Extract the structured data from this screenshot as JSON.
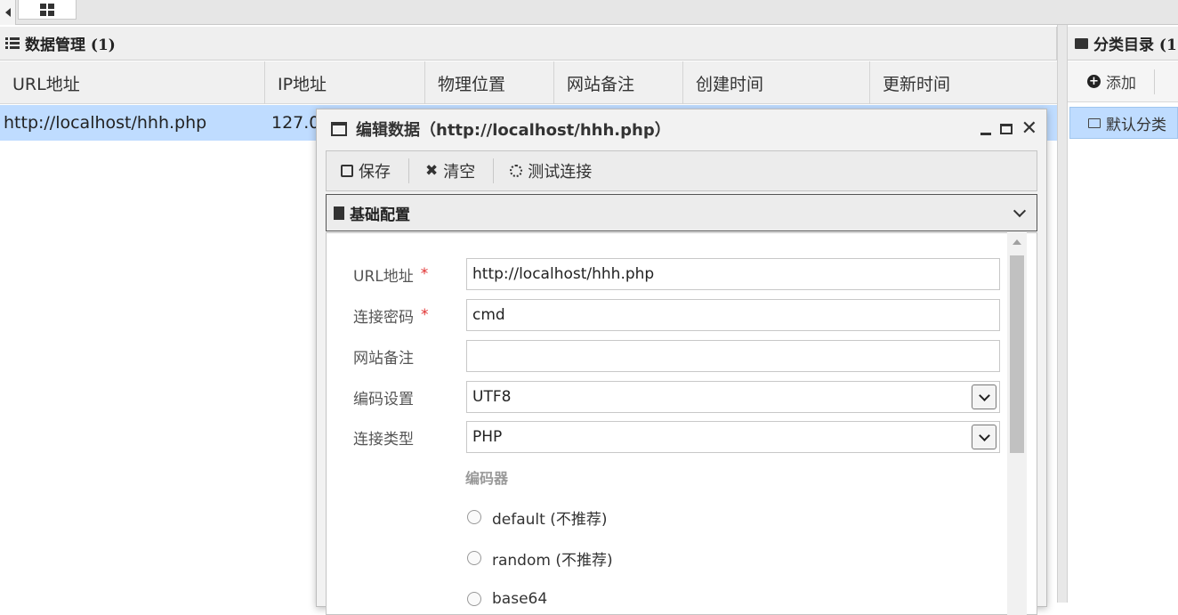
{
  "tabs": {
    "prev_icon": "caret-left-icon",
    "home_icon": "grid-icon"
  },
  "left_panel": {
    "title": "数据管理 (1)",
    "columns": [
      "URL地址",
      "IP地址",
      "物理位置",
      "网站备注",
      "创建时间",
      "更新时间"
    ],
    "rows": [
      {
        "url": "http://localhost/hhh.php",
        "ip": "127.0"
      }
    ]
  },
  "right_panel": {
    "title": "分类目录 (1",
    "add_label": "添加",
    "items": [
      "默认分类"
    ]
  },
  "dialog": {
    "title": "编辑数据（http://localhost/hhh.php）",
    "toolbar": {
      "save": "保存",
      "clear": "清空",
      "test": "测试连接"
    },
    "section": "基础配置",
    "fields": {
      "url_label": "URL地址",
      "url_value": "http://localhost/hhh.php",
      "password_label": "连接密码",
      "password_value": "cmd",
      "note_label": "网站备注",
      "note_value": "",
      "encoding_label": "编码设置",
      "encoding_value": "UTF8",
      "type_label": "连接类型",
      "type_value": "PHP",
      "required_mark": "*"
    },
    "encoder_label": "编码器",
    "encoders": [
      "default (不推荐)",
      "random (不推荐)",
      "base64"
    ]
  }
}
